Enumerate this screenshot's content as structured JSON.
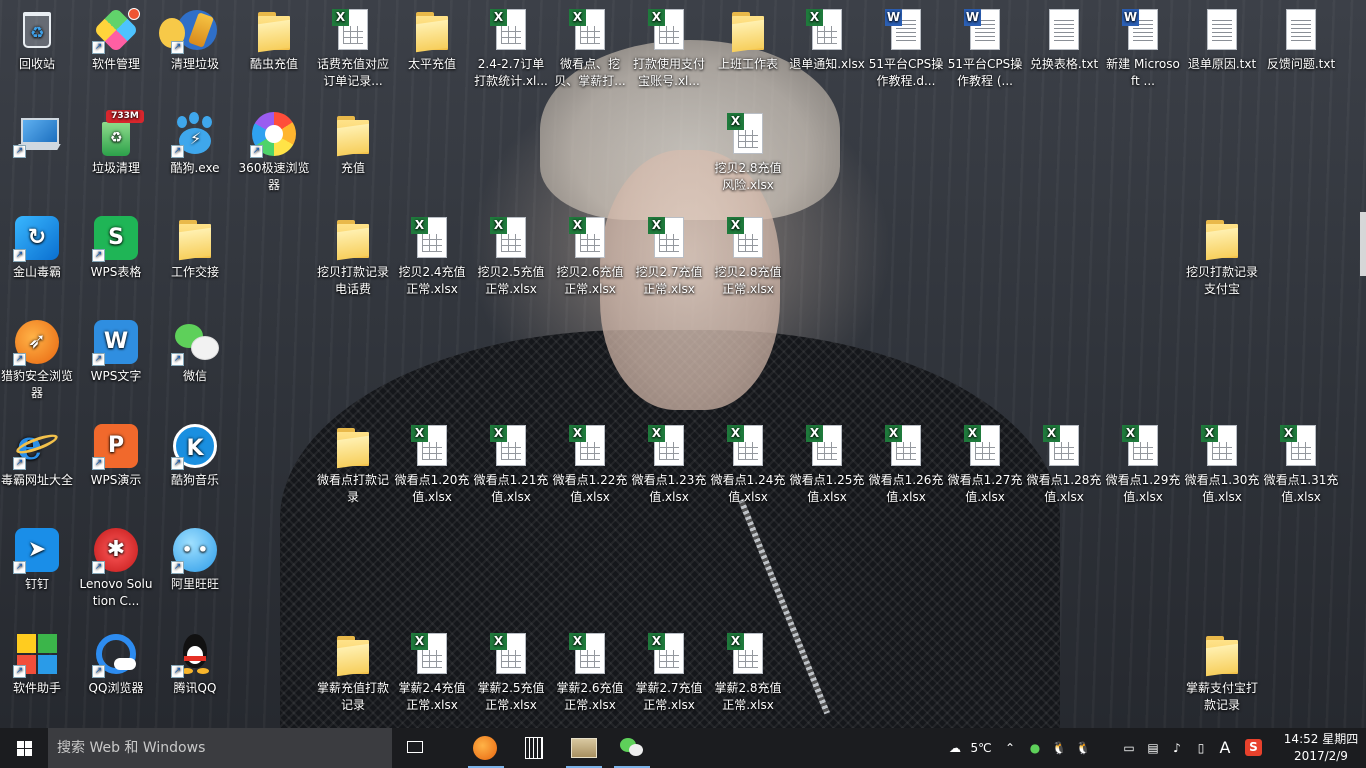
{
  "desktop": {
    "wallpaper": "portrait-photo",
    "icons": {
      "recycle": "回收站",
      "software_mgr": "软件管理",
      "clean_trash": "清理垃圾",
      "kuchong": "酷虫充值",
      "huafei": "话费充值对应订单记录...",
      "taiping": "太平充值",
      "order_24_27": "2.4-2.7订单打款统计.xl...",
      "weikan_wa": "微看点、挖贝、掌薪打...",
      "pay_alipay": "打款使用支付宝账号.xl...",
      "work_table": "上班工作表",
      "tuidan_notice": "退单通知.xlsx",
      "cps_doc1": "51平台CPS操作教程.d...",
      "cps_doc2": "51平台CPS操作教程 (...",
      "exchange_txt": "兑换表格.txt",
      "new_ms": "新建 Microsoft ...",
      "tuidan_reason": "退单原因.txt",
      "feedback": "反馈问题.txt",
      "computer": "",
      "junk_clean": "垃圾清理",
      "junk_badge": "733M",
      "kugou_exe": "酷狗.exe",
      "browser360": "360极速浏览器",
      "chongzhi": "充值",
      "wabei_28_risk": "挖贝2.8充值风险.xlsx",
      "jinshan": "金山毒霸",
      "wps_sheet": "WPS表格",
      "work_handover": "工作交接",
      "wabei_phone": "挖贝打款记录电话费",
      "wabei_24": "挖贝2.4充值正常.xlsx",
      "wabei_25": "挖贝2.5充值正常.xlsx",
      "wabei_26": "挖贝2.6充值正常.xlsx",
      "wabei_27": "挖贝2.7充值正常.xlsx",
      "wabei_28": "挖贝2.8充值正常.xlsx",
      "wabei_alipay": "挖贝打款记录支付宝",
      "liebao": "猎豹安全浏览器",
      "wps_word": "WPS文字",
      "wechat": "微信",
      "duba_nav": "毒霸网址大全",
      "wps_ppt": "WPS演示",
      "kugou_music": "酷狗音乐",
      "wkd_record": "微看点打款记录",
      "wkd_120": "微看点1.20充值.xlsx",
      "wkd_121": "微看点1.21充值.xlsx",
      "wkd_122": "微看点1.22充值.xlsx",
      "wkd_123": "微看点1.23充值.xlsx",
      "wkd_124": "微看点1.24充值.xlsx",
      "wkd_125": "微看点1.25充值.xlsx",
      "wkd_126": "微看点1.26充值.xlsx",
      "wkd_127": "微看点1.27充值.xlsx",
      "wkd_128": "微看点1.28充值.xlsx",
      "wkd_129": "微看点1.29充值.xlsx",
      "wkd_130": "微看点1.30充值.xlsx",
      "wkd_131": "微看点1.31充值.xlsx",
      "dingding": "钉钉",
      "lenovo": "Lenovo Solution C...",
      "aliwang": "阿里旺旺",
      "soft_helper": "软件助手",
      "qq_browser": "QQ浏览器",
      "tencent_qq": "腾讯QQ",
      "zx_record": "掌薪充值打款记录",
      "zx_24": "掌薪2.4充值正常.xlsx",
      "zx_25": "掌薪2.5充值正常.xlsx",
      "zx_26": "掌薪2.6充值正常.xlsx",
      "zx_27": "掌薪2.7充值正常.xlsx",
      "zx_28": "掌薪2.8充值正常.xlsx",
      "zx_alipay": "掌薪支付宝打款记录"
    }
  },
  "taskbar": {
    "search_placeholder": "搜索 Web 和 Windows",
    "weather_temp": "5℃",
    "ime_label": "A",
    "time": "14:52 星期四",
    "date": "2017/2/9"
  },
  "colors": {
    "excel_green": "#1f7a3c",
    "word_blue": "#2b5fb4",
    "folder_yellow": "#f3c24a",
    "taskbar": "#1b1c1f",
    "search_bg": "#3b3c40"
  }
}
